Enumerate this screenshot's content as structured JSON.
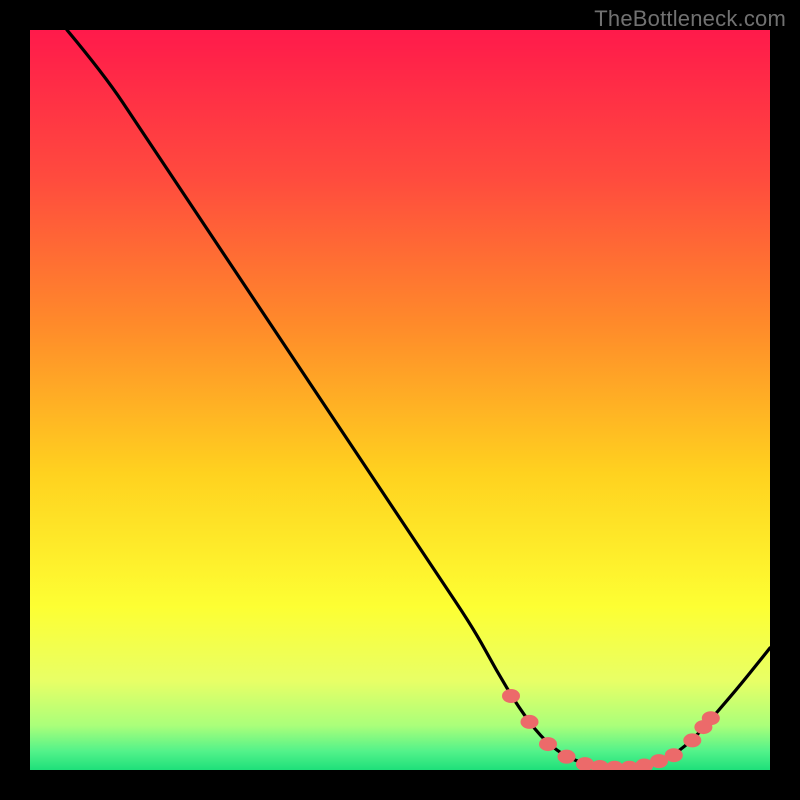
{
  "watermark": "TheBottleneck.com",
  "chart_data": {
    "type": "line",
    "title": "",
    "xlabel": "",
    "ylabel": "",
    "xlim": [
      0,
      100
    ],
    "ylim": [
      0,
      100
    ],
    "gradient_stops": [
      {
        "offset": 0.0,
        "color": "#ff1a4b"
      },
      {
        "offset": 0.2,
        "color": "#ff4b3e"
      },
      {
        "offset": 0.4,
        "color": "#ff8b2a"
      },
      {
        "offset": 0.6,
        "color": "#ffd21f"
      },
      {
        "offset": 0.78,
        "color": "#fdff33"
      },
      {
        "offset": 0.88,
        "color": "#e8ff66"
      },
      {
        "offset": 0.94,
        "color": "#aaff7a"
      },
      {
        "offset": 0.975,
        "color": "#52f28a"
      },
      {
        "offset": 1.0,
        "color": "#1ee07a"
      }
    ],
    "curve": [
      {
        "x": 5.0,
        "y": 100.0
      },
      {
        "x": 10.0,
        "y": 94.0
      },
      {
        "x": 15.0,
        "y": 86.5
      },
      {
        "x": 20.0,
        "y": 79.0
      },
      {
        "x": 25.0,
        "y": 71.5
      },
      {
        "x": 30.0,
        "y": 64.0
      },
      {
        "x": 35.0,
        "y": 56.5
      },
      {
        "x": 40.0,
        "y": 49.0
      },
      {
        "x": 45.0,
        "y": 41.5
      },
      {
        "x": 50.0,
        "y": 34.0
      },
      {
        "x": 55.0,
        "y": 26.5
      },
      {
        "x": 60.0,
        "y": 19.0
      },
      {
        "x": 63.0,
        "y": 13.5
      },
      {
        "x": 66.0,
        "y": 8.5
      },
      {
        "x": 69.0,
        "y": 4.5
      },
      {
        "x": 72.0,
        "y": 2.0
      },
      {
        "x": 75.0,
        "y": 0.8
      },
      {
        "x": 78.0,
        "y": 0.3
      },
      {
        "x": 81.0,
        "y": 0.3
      },
      {
        "x": 84.0,
        "y": 0.8
      },
      {
        "x": 87.0,
        "y": 2.0
      },
      {
        "x": 90.0,
        "y": 4.5
      },
      {
        "x": 93.0,
        "y": 8.0
      },
      {
        "x": 96.0,
        "y": 11.5
      },
      {
        "x": 100.0,
        "y": 16.5
      }
    ],
    "markers": [
      {
        "x": 65.0,
        "y": 10.0
      },
      {
        "x": 67.5,
        "y": 6.5
      },
      {
        "x": 70.0,
        "y": 3.5
      },
      {
        "x": 72.5,
        "y": 1.8
      },
      {
        "x": 75.0,
        "y": 0.8
      },
      {
        "x": 77.0,
        "y": 0.4
      },
      {
        "x": 79.0,
        "y": 0.3
      },
      {
        "x": 81.0,
        "y": 0.3
      },
      {
        "x": 83.0,
        "y": 0.6
      },
      {
        "x": 85.0,
        "y": 1.2
      },
      {
        "x": 87.0,
        "y": 2.0
      },
      {
        "x": 89.5,
        "y": 4.0
      },
      {
        "x": 91.0,
        "y": 5.8
      },
      {
        "x": 92.0,
        "y": 7.0
      }
    ],
    "marker_color": "#ec6a6a",
    "curve_color": "#000000",
    "curve_width": 3.2
  }
}
